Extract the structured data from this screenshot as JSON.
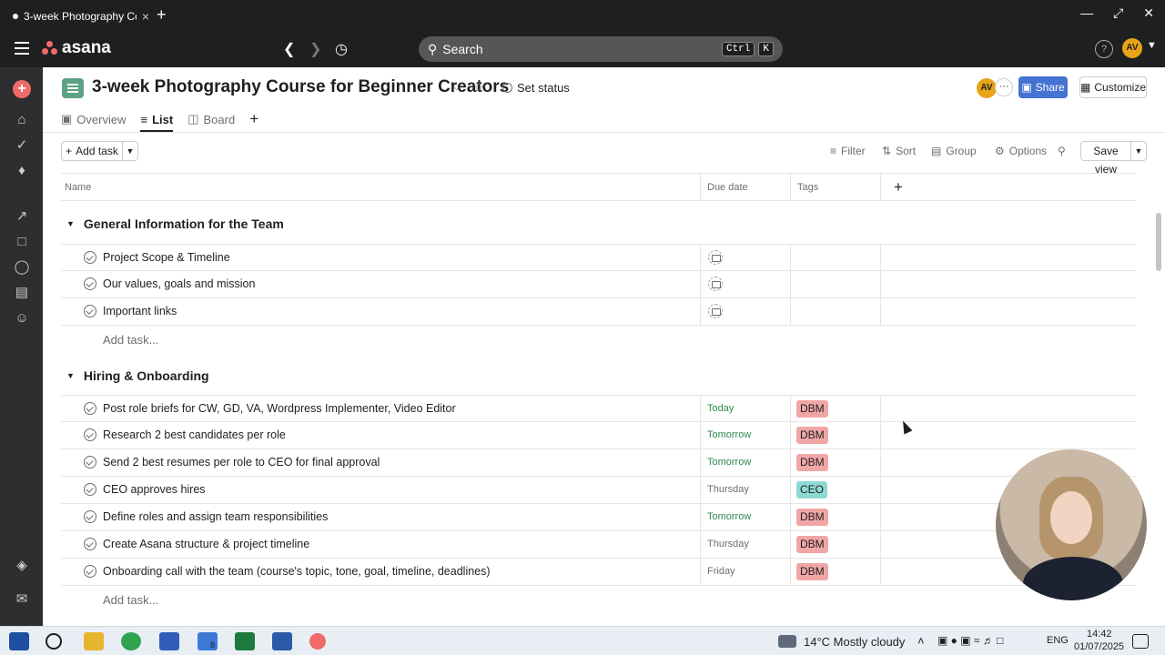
{
  "browser": {
    "tab_title": "3-week Photography Cou…",
    "new_tab": "+",
    "close": "×"
  },
  "app": {
    "logo": "asana",
    "search_placeholder": "Search",
    "shortcut_keys": [
      "Ctrl",
      "K"
    ],
    "help": "?",
    "user_initials": "AV"
  },
  "project": {
    "title": "3-week Photography Course for Beginner Creators",
    "set_status": "Set status",
    "member_initials": "AV",
    "more": "···",
    "share": "Share",
    "customize": "Customize",
    "accent_color": "#5da283"
  },
  "tabs": [
    {
      "label": "Overview",
      "active": false
    },
    {
      "label": "List",
      "active": true
    },
    {
      "label": "Board",
      "active": false
    }
  ],
  "toolbar": {
    "add_task": "Add task",
    "filter": "Filter",
    "sort": "Sort",
    "group": "Group",
    "options": "Options",
    "save_view": "Save view"
  },
  "table": {
    "columns": [
      "Name",
      "Due date",
      "Tags"
    ],
    "add_column": "+"
  },
  "sections": [
    {
      "title": "General Information for the Team",
      "tasks": [
        {
          "name": "Project Scope & Timeline",
          "due": "",
          "tag": ""
        },
        {
          "name": "Our values, goals and mission",
          "due": "",
          "tag": ""
        },
        {
          "name": "Important links",
          "due": "",
          "tag": ""
        }
      ],
      "add_task": "Add task..."
    },
    {
      "title": "Hiring & Onboarding",
      "tasks": [
        {
          "name": "Post role briefs for CW, GD, VA, Wordpress Implementer, Video Editor",
          "due": "Today",
          "tag": "DBM"
        },
        {
          "name": "Research 2 best candidates per role",
          "due": "Tomorrow",
          "tag": "DBM"
        },
        {
          "name": "Send 2 best resumes per role to CEO for final approval",
          "due": "Tomorrow",
          "tag": "DBM"
        },
        {
          "name": "CEO approves hires",
          "due": "Thursday",
          "tag": "CEO"
        },
        {
          "name": "Define roles and assign team responsibilities",
          "due": "Tomorrow",
          "tag": "DBM"
        },
        {
          "name": "Create Asana structure & project timeline",
          "due": "Thursday",
          "tag": "DBM"
        },
        {
          "name": "Onboarding call with the team (course's topic, tone, goal, timeline, deadlines)",
          "due": "Friday",
          "tag": "DBM"
        }
      ],
      "add_task": "Add task..."
    }
  ],
  "colors": {
    "due_green": "#2f8a4f",
    "due_gray": "#6d6e6f",
    "tag_dbm": "#f1a6a6",
    "tag_ceo": "#8fd9d5",
    "brand_red": "#f06a6a",
    "share_blue": "#4573d2"
  },
  "taskbar": {
    "weather": "14°C  Mostly cloudy",
    "lang": "ENG",
    "time": "14:42",
    "date": "01/07/2025",
    "mail_badge": "8"
  }
}
